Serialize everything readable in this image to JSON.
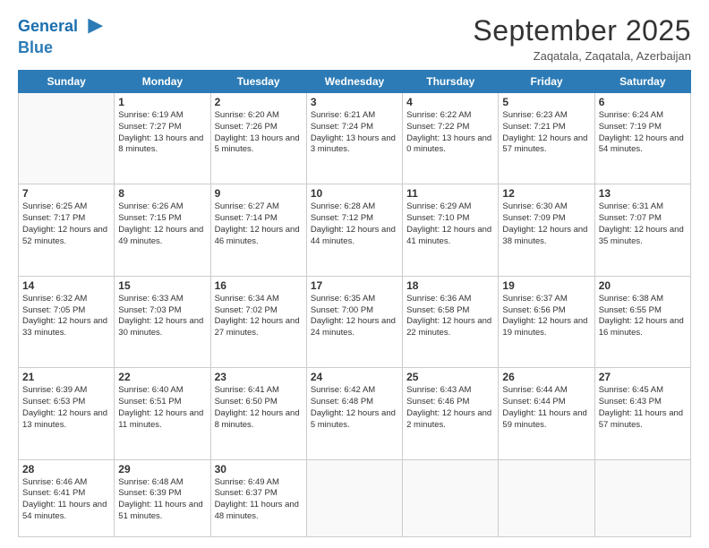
{
  "logo": {
    "line1": "General",
    "line2": "Blue"
  },
  "header": {
    "month": "September 2025",
    "location": "Zaqatala, Zaqatala, Azerbaijan"
  },
  "days_of_week": [
    "Sunday",
    "Monday",
    "Tuesday",
    "Wednesday",
    "Thursday",
    "Friday",
    "Saturday"
  ],
  "weeks": [
    [
      {
        "day": "",
        "empty": true
      },
      {
        "day": "1",
        "sunrise": "Sunrise: 6:19 AM",
        "sunset": "Sunset: 7:27 PM",
        "daylight": "Daylight: 13 hours and 8 minutes."
      },
      {
        "day": "2",
        "sunrise": "Sunrise: 6:20 AM",
        "sunset": "Sunset: 7:26 PM",
        "daylight": "Daylight: 13 hours and 5 minutes."
      },
      {
        "day": "3",
        "sunrise": "Sunrise: 6:21 AM",
        "sunset": "Sunset: 7:24 PM",
        "daylight": "Daylight: 13 hours and 3 minutes."
      },
      {
        "day": "4",
        "sunrise": "Sunrise: 6:22 AM",
        "sunset": "Sunset: 7:22 PM",
        "daylight": "Daylight: 13 hours and 0 minutes."
      },
      {
        "day": "5",
        "sunrise": "Sunrise: 6:23 AM",
        "sunset": "Sunset: 7:21 PM",
        "daylight": "Daylight: 12 hours and 57 minutes."
      },
      {
        "day": "6",
        "sunrise": "Sunrise: 6:24 AM",
        "sunset": "Sunset: 7:19 PM",
        "daylight": "Daylight: 12 hours and 54 minutes."
      }
    ],
    [
      {
        "day": "7",
        "sunrise": "Sunrise: 6:25 AM",
        "sunset": "Sunset: 7:17 PM",
        "daylight": "Daylight: 12 hours and 52 minutes."
      },
      {
        "day": "8",
        "sunrise": "Sunrise: 6:26 AM",
        "sunset": "Sunset: 7:15 PM",
        "daylight": "Daylight: 12 hours and 49 minutes."
      },
      {
        "day": "9",
        "sunrise": "Sunrise: 6:27 AM",
        "sunset": "Sunset: 7:14 PM",
        "daylight": "Daylight: 12 hours and 46 minutes."
      },
      {
        "day": "10",
        "sunrise": "Sunrise: 6:28 AM",
        "sunset": "Sunset: 7:12 PM",
        "daylight": "Daylight: 12 hours and 44 minutes."
      },
      {
        "day": "11",
        "sunrise": "Sunrise: 6:29 AM",
        "sunset": "Sunset: 7:10 PM",
        "daylight": "Daylight: 12 hours and 41 minutes."
      },
      {
        "day": "12",
        "sunrise": "Sunrise: 6:30 AM",
        "sunset": "Sunset: 7:09 PM",
        "daylight": "Daylight: 12 hours and 38 minutes."
      },
      {
        "day": "13",
        "sunrise": "Sunrise: 6:31 AM",
        "sunset": "Sunset: 7:07 PM",
        "daylight": "Daylight: 12 hours and 35 minutes."
      }
    ],
    [
      {
        "day": "14",
        "sunrise": "Sunrise: 6:32 AM",
        "sunset": "Sunset: 7:05 PM",
        "daylight": "Daylight: 12 hours and 33 minutes."
      },
      {
        "day": "15",
        "sunrise": "Sunrise: 6:33 AM",
        "sunset": "Sunset: 7:03 PM",
        "daylight": "Daylight: 12 hours and 30 minutes."
      },
      {
        "day": "16",
        "sunrise": "Sunrise: 6:34 AM",
        "sunset": "Sunset: 7:02 PM",
        "daylight": "Daylight: 12 hours and 27 minutes."
      },
      {
        "day": "17",
        "sunrise": "Sunrise: 6:35 AM",
        "sunset": "Sunset: 7:00 PM",
        "daylight": "Daylight: 12 hours and 24 minutes."
      },
      {
        "day": "18",
        "sunrise": "Sunrise: 6:36 AM",
        "sunset": "Sunset: 6:58 PM",
        "daylight": "Daylight: 12 hours and 22 minutes."
      },
      {
        "day": "19",
        "sunrise": "Sunrise: 6:37 AM",
        "sunset": "Sunset: 6:56 PM",
        "daylight": "Daylight: 12 hours and 19 minutes."
      },
      {
        "day": "20",
        "sunrise": "Sunrise: 6:38 AM",
        "sunset": "Sunset: 6:55 PM",
        "daylight": "Daylight: 12 hours and 16 minutes."
      }
    ],
    [
      {
        "day": "21",
        "sunrise": "Sunrise: 6:39 AM",
        "sunset": "Sunset: 6:53 PM",
        "daylight": "Daylight: 12 hours and 13 minutes."
      },
      {
        "day": "22",
        "sunrise": "Sunrise: 6:40 AM",
        "sunset": "Sunset: 6:51 PM",
        "daylight": "Daylight: 12 hours and 11 minutes."
      },
      {
        "day": "23",
        "sunrise": "Sunrise: 6:41 AM",
        "sunset": "Sunset: 6:50 PM",
        "daylight": "Daylight: 12 hours and 8 minutes."
      },
      {
        "day": "24",
        "sunrise": "Sunrise: 6:42 AM",
        "sunset": "Sunset: 6:48 PM",
        "daylight": "Daylight: 12 hours and 5 minutes."
      },
      {
        "day": "25",
        "sunrise": "Sunrise: 6:43 AM",
        "sunset": "Sunset: 6:46 PM",
        "daylight": "Daylight: 12 hours and 2 minutes."
      },
      {
        "day": "26",
        "sunrise": "Sunrise: 6:44 AM",
        "sunset": "Sunset: 6:44 PM",
        "daylight": "Daylight: 11 hours and 59 minutes."
      },
      {
        "day": "27",
        "sunrise": "Sunrise: 6:45 AM",
        "sunset": "Sunset: 6:43 PM",
        "daylight": "Daylight: 11 hours and 57 minutes."
      }
    ],
    [
      {
        "day": "28",
        "sunrise": "Sunrise: 6:46 AM",
        "sunset": "Sunset: 6:41 PM",
        "daylight": "Daylight: 11 hours and 54 minutes."
      },
      {
        "day": "29",
        "sunrise": "Sunrise: 6:48 AM",
        "sunset": "Sunset: 6:39 PM",
        "daylight": "Daylight: 11 hours and 51 minutes."
      },
      {
        "day": "30",
        "sunrise": "Sunrise: 6:49 AM",
        "sunset": "Sunset: 6:37 PM",
        "daylight": "Daylight: 11 hours and 48 minutes."
      },
      {
        "day": "",
        "empty": true
      },
      {
        "day": "",
        "empty": true
      },
      {
        "day": "",
        "empty": true
      },
      {
        "day": "",
        "empty": true
      }
    ]
  ]
}
